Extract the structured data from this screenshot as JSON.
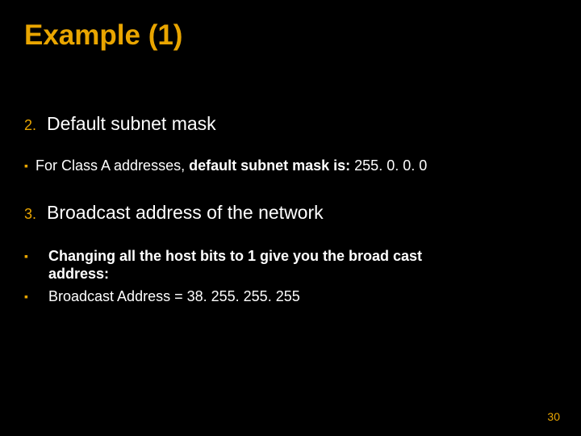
{
  "title": "Example (1)",
  "item2": {
    "marker": "2.",
    "text": "Default subnet mask"
  },
  "sub2": {
    "marker": "▪",
    "prefix": "For Class A addresses, ",
    "bold": "default subnet mask is: ",
    "value": "255. 0. 0. 0"
  },
  "item3": {
    "marker": "3.",
    "text": "Broadcast address of the network"
  },
  "sub3a": {
    "marker": "▪",
    "line1": "Changing all the host bits to 1 give you the broad cast",
    "line2": "address:"
  },
  "sub3b": {
    "marker": "▪",
    "text": " Broadcast Address  = 38. 255. 255. 255"
  },
  "pageNumber": "30"
}
